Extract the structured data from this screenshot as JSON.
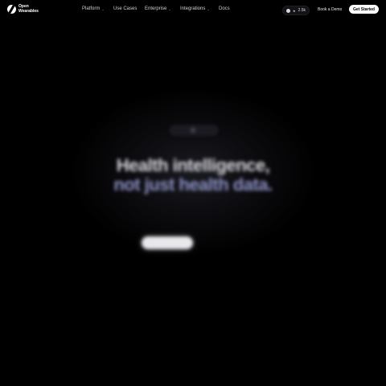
{
  "brand": {
    "name_line1": "Open",
    "name_line2": "Wearables"
  },
  "nav": {
    "platform": "Platform",
    "use_cases": "Use Cases",
    "enterprise": "Enterprise",
    "integrations": "Integrations",
    "docs": "Docs",
    "chevron": "⌄",
    "github_stars": "2.5k",
    "book_demo": "Book a Demo",
    "get_started": "Get Started"
  },
  "hero": {
    "badge": "",
    "eyebrow": "",
    "headline_line1": "Health intelligence,",
    "headline_line2": "not just health data.",
    "subtitle_line1": "",
    "subtitle_line2": "",
    "cta_primary": "",
    "cta_secondary": ""
  },
  "footer": {
    "label": "",
    "logos": []
  },
  "colors": {
    "background": "#000000",
    "headline": "#d9d9de",
    "headline_accent": "#8f93c7",
    "primary_button": "#ffffff"
  }
}
